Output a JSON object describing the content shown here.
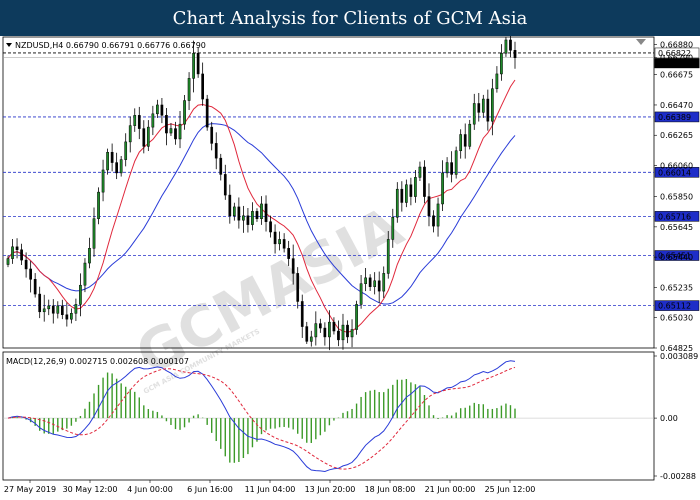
{
  "banner": {
    "title": "Chart Analysis for Clients of GCM Asia"
  },
  "watermark": {
    "text": "GCMASIA",
    "subtext": "GCM ASIA COMMUNITY MARKETS"
  },
  "chart_data": {
    "type": "candlestick",
    "main": {
      "header": "NZDUSD,H4  0.66790 0.66791 0.66776 0.66790",
      "ylim": [
        0.64825,
        0.6693
      ],
      "y_ticks": [
        "0.66880",
        "0.66790",
        "0.66675",
        "0.66470",
        "0.66265",
        "0.66060",
        "0.65850",
        "0.65645",
        "0.65440",
        "0.65235",
        "0.65030",
        "0.64825"
      ],
      "horizontal_levels": [
        {
          "label": "0.66822",
          "value": 0.66822,
          "style": "dashed-black",
          "box": "white"
        },
        {
          "label": "0.66389",
          "value": 0.66389,
          "style": "dashed-blue",
          "box": "blue"
        },
        {
          "label": "0.66014",
          "value": 0.66014,
          "style": "dashed-blue",
          "box": "blue"
        },
        {
          "label": "0.65716",
          "value": 0.65716,
          "style": "dashed-blue",
          "box": "blue"
        },
        {
          "label": "0.65451",
          "value": 0.65451,
          "style": "dashed-blue",
          "box": "blue"
        },
        {
          "label": "0.65112",
          "value": 0.65112,
          "style": "dashed-blue",
          "box": "blue"
        }
      ],
      "current_price": "0.66790",
      "series_colors": {
        "fast_ma": "#e0283c",
        "slow_ma": "#2a3cd8",
        "bull": "#1f8a2a",
        "bear": "#000000"
      }
    },
    "macd": {
      "header": "MACD(12,26,9) 0.002715 0.002608 0.000107",
      "ylim": [
        -0.00288,
        0.003089
      ],
      "y_ticks": [
        "0.003089",
        "0.00",
        "-0.00288"
      ],
      "colors": {
        "histogram": "#3c9a28",
        "macd_line": "#2a3cd8",
        "signal_line": "#e0283c"
      }
    },
    "x_ticks": [
      "27 May 2019",
      "30 May 12:00",
      "4 Jun 00:00",
      "6 Jun 16:00",
      "11 Jun 04:00",
      "13 Jun 20:00",
      "18 Jun 08:00",
      "21 Jun 00:00",
      "25 Jun 12:00"
    ],
    "closes": [
      0.6543,
      0.6551,
      0.6549,
      0.6542,
      0.6536,
      0.6529,
      0.6519,
      0.6507,
      0.6509,
      0.6511,
      0.6506,
      0.6511,
      0.6505,
      0.6502,
      0.6506,
      0.6512,
      0.6525,
      0.654,
      0.655,
      0.657,
      0.6588,
      0.6603,
      0.6615,
      0.6608,
      0.6601,
      0.661,
      0.6622,
      0.6633,
      0.664,
      0.6631,
      0.6619,
      0.6632,
      0.6641,
      0.6647,
      0.664,
      0.6628,
      0.6631,
      0.6624,
      0.6634,
      0.665,
      0.6665,
      0.6682,
      0.6668,
      0.6651,
      0.6632,
      0.6621,
      0.6611,
      0.66,
      0.6586,
      0.6572,
      0.6578,
      0.6569,
      0.6572,
      0.6566,
      0.6575,
      0.657,
      0.658,
      0.6568,
      0.6561,
      0.6553,
      0.6556,
      0.655,
      0.6543,
      0.6533,
      0.6514,
      0.6497,
      0.6487,
      0.649,
      0.6499,
      0.6496,
      0.649,
      0.65,
      0.6494,
      0.6488,
      0.6498,
      0.649,
      0.6495,
      0.6512,
      0.6526,
      0.653,
      0.6524,
      0.6528,
      0.6521,
      0.6533,
      0.6556,
      0.6571,
      0.659,
      0.6581,
      0.6593,
      0.6585,
      0.6598,
      0.6605,
      0.6585,
      0.6572,
      0.6565,
      0.658,
      0.6601,
      0.6608,
      0.66,
      0.6616,
      0.6627,
      0.6619,
      0.6634,
      0.6648,
      0.6642,
      0.6651,
      0.6636,
      0.6658,
      0.6668,
      0.6682,
      0.6691,
      0.6684,
      0.6679
    ]
  }
}
